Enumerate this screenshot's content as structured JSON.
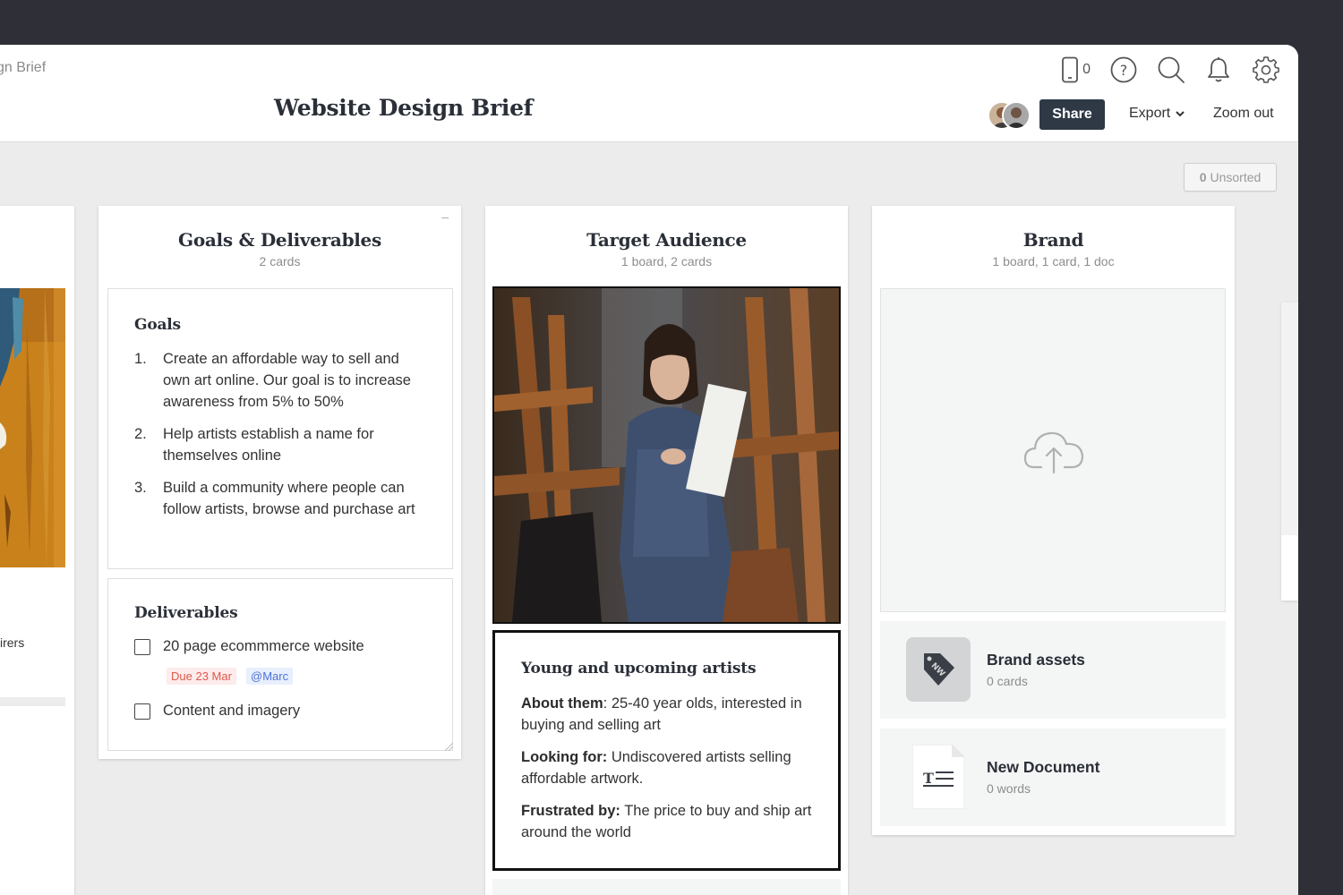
{
  "header": {
    "breadcrumb": "gn Brief",
    "title": "Website Design Brief",
    "device_count": "0",
    "share_label": "Share",
    "export_label": "Export",
    "zoom_label": "Zoom out"
  },
  "toolbar": {
    "unsorted_count": "0",
    "unsorted_label": "Unsorted"
  },
  "left_column": {
    "partial_text": "irers"
  },
  "columns": {
    "goals": {
      "title": "Goals & Deliverables",
      "subtitle": "2 cards",
      "collapse_label": "–",
      "goals_card": {
        "title": "Goals",
        "items": [
          {
            "num": "1.",
            "text": "Create an affordable way to sell and own art online. Our goal is to increase awareness from 5% to 50%"
          },
          {
            "num": "2.",
            "text": "Help artists establish a name for themselves online"
          },
          {
            "num": "3.",
            "text": "Build a community where people can follow artists, browse and purchase art"
          }
        ]
      },
      "deliverables_card": {
        "title": "Deliverables",
        "items": [
          {
            "text": "20 page ecommmerce website"
          },
          {
            "text": "Content and imagery"
          }
        ],
        "due_tag": "Due 23 Mar",
        "user_tag": "@Marc"
      }
    },
    "audience": {
      "title": "Target Audience",
      "subtitle": "1 board, 2 cards",
      "text_card": {
        "title": "Young and upcoming artists",
        "about_label": "About them",
        "about_text": ": 25-40 year olds, interested in buying and selling art",
        "looking_label": "Looking for:",
        "looking_text": " Undiscovered artists selling affordable artwork.",
        "frustrated_label": "Frustrated by:",
        "frustrated_text": " The price to buy and ship art around the world"
      }
    },
    "brand": {
      "title": "Brand",
      "subtitle": "1 board, 1 card, 1 doc",
      "assets": {
        "title": "Brand assets",
        "sub": "0 cards",
        "icon_text": "NW"
      },
      "document": {
        "title": "New Document",
        "sub": "0 words"
      }
    }
  },
  "colors": {
    "frame": "#2f2f38",
    "canvas": "#ececec",
    "share_bg": "#2f3946",
    "due_tag": "#e0584c",
    "user_tag": "#4e72d6"
  }
}
